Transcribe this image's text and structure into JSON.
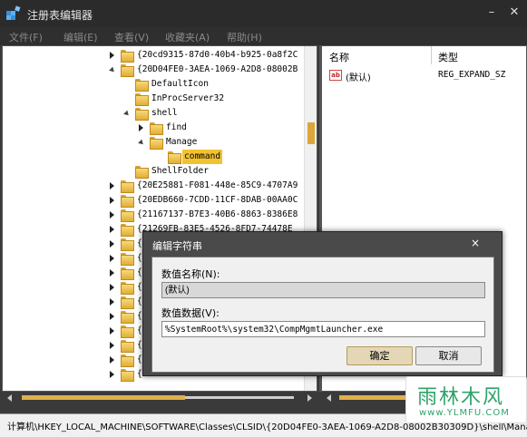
{
  "window": {
    "title": "注册表编辑器",
    "min": "–",
    "close": "✕"
  },
  "menu": [
    "文件(F)",
    "编辑(E)",
    "查看(V)",
    "收藏夹(A)",
    "帮助(H)"
  ],
  "tree": [
    {
      "label": "{20cd9315-87d0-40b4-b925-0a8f2C",
      "toggle": "collapsed"
    },
    {
      "label": "{20D04FE0-3AEA-1069-A2D8-08002B",
      "toggle": "expanded"
    },
    {
      "label": "DefaultIcon",
      "toggle": "none"
    },
    {
      "label": "InProcServer32",
      "toggle": "none"
    },
    {
      "label": "shell",
      "toggle": "expanded"
    },
    {
      "label": "find",
      "toggle": "collapsed"
    },
    {
      "label": "Manage",
      "toggle": "expanded"
    },
    {
      "label": "command",
      "toggle": "none",
      "selected": true
    },
    {
      "label": "ShellFolder",
      "toggle": "none"
    },
    {
      "label": "{20E25881-F081-448e-85C9-4707A9",
      "toggle": "collapsed"
    },
    {
      "label": "{20EDB660-7CDD-11CF-8DAB-00AA0C",
      "toggle": "collapsed"
    },
    {
      "label": "{21167137-B7E3-40B6-8863-8386E8",
      "toggle": "collapsed"
    },
    {
      "label": "{21269FB-83E5-4526-8FD7-74478E",
      "toggle": "collapsed"
    },
    {
      "label": "{2",
      "toggle": "collapsed"
    },
    {
      "label": "{2",
      "toggle": "collapsed"
    },
    {
      "label": "{2",
      "toggle": "collapsed"
    },
    {
      "label": "{2",
      "toggle": "collapsed"
    },
    {
      "label": "{2",
      "toggle": "collapsed"
    },
    {
      "label": "{2",
      "toggle": "collapsed"
    },
    {
      "label": "{2",
      "toggle": "collapsed"
    },
    {
      "label": "{2",
      "toggle": "collapsed"
    },
    {
      "label": "{2",
      "toggle": "collapsed"
    },
    {
      "label": "{2206CDB2-19C1-11D1-89E0-00C04F",
      "toggle": "collapsed"
    }
  ],
  "values_panel": {
    "col_name": "名称",
    "col_type": "类型",
    "rows": [
      {
        "icon": "ab",
        "name": "(默认)",
        "type": "REG_EXPAND_SZ"
      }
    ]
  },
  "statusbar": {
    "path": "计算机\\HKEY_LOCAL_MACHINE\\SOFTWARE\\Classes\\CLSID\\{20D04FE0-3AEA-1069-A2D8-08002B30309D}\\shell\\Manage\\command"
  },
  "dialog": {
    "title": "编辑字符串",
    "close": "×",
    "name_label": "数值名称(N):",
    "name_value": "(默认)",
    "data_label": "数值数据(V):",
    "data_value": "%SystemRoot%\\system32\\CompMgmtLauncher.exe",
    "ok": "确定",
    "cancel": "取消"
  },
  "watermark": {
    "line1": "雨林木风",
    "line2": "www.YLMFU.COM"
  },
  "colors": {
    "selection": "#f2c230",
    "folder": "#e0ae34",
    "scroll_thumb": "#e0b04c"
  }
}
